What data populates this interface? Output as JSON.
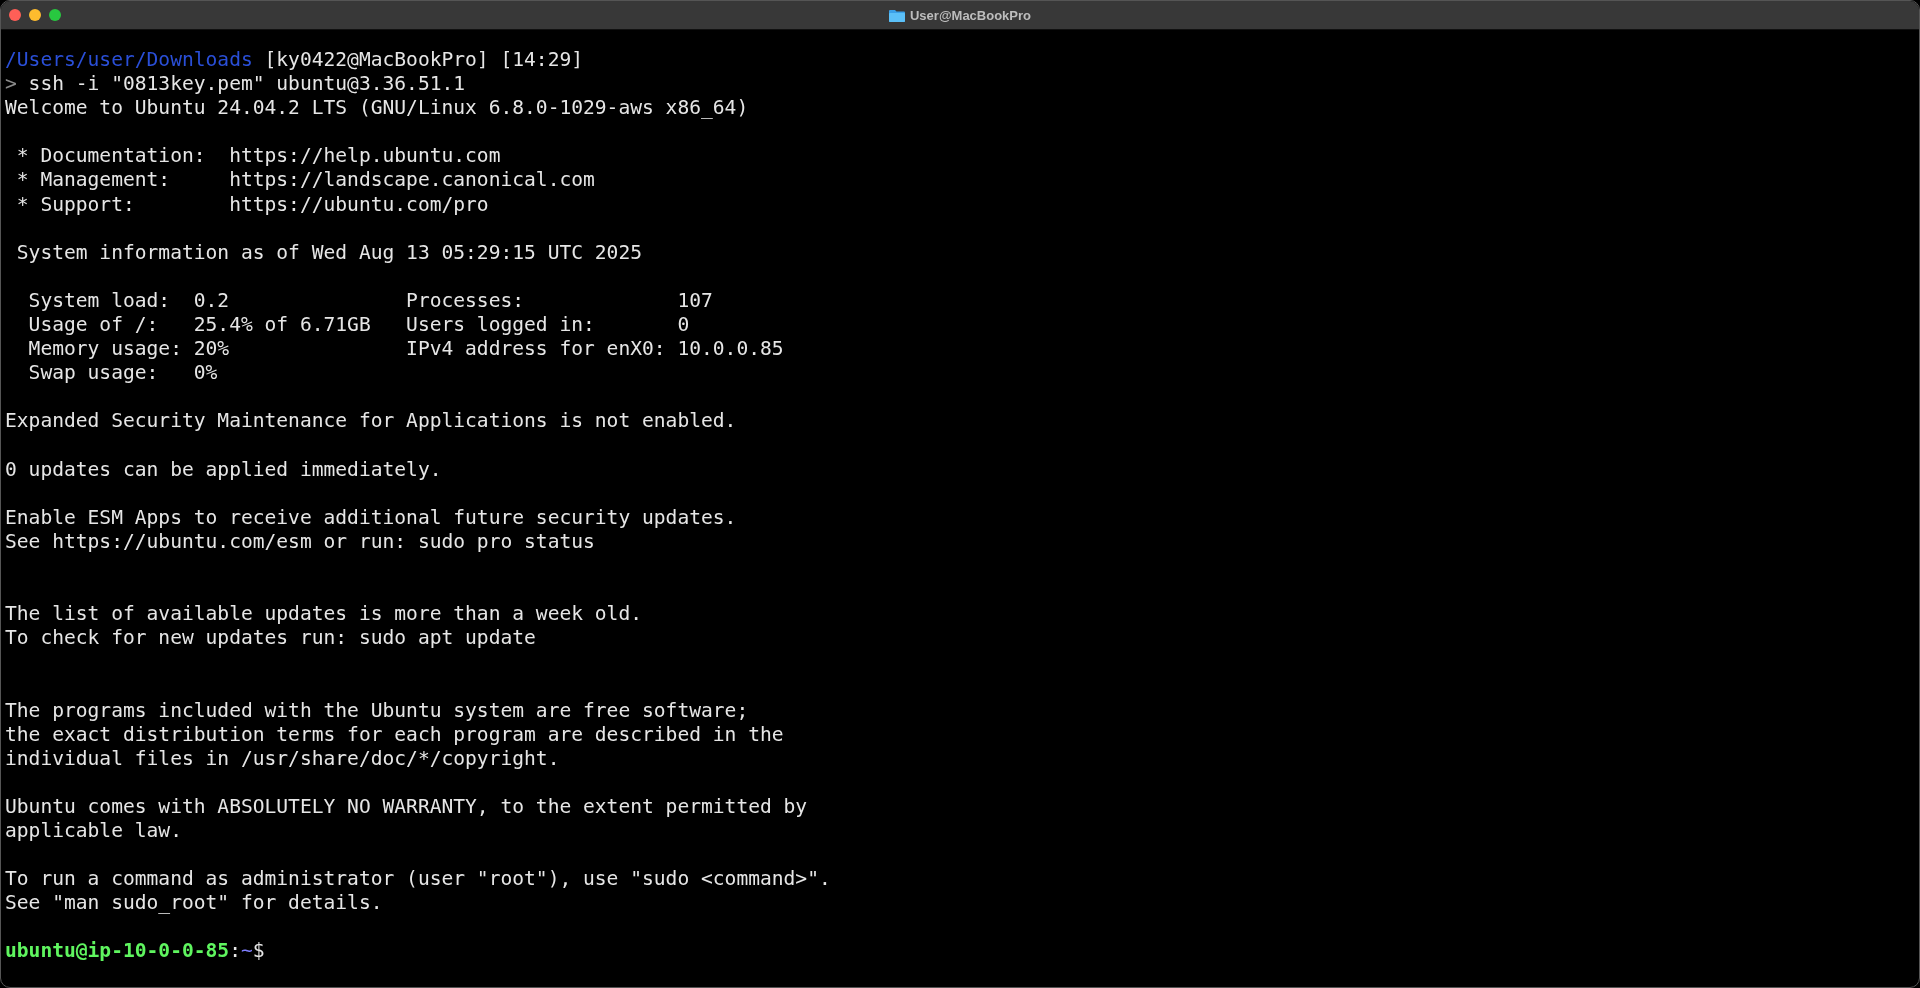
{
  "window": {
    "title": "User@MacBookPro"
  },
  "terminal": {
    "lines": [
      {
        "kind": "segments",
        "segments": [
          {
            "text": "/Users/user/Downloads",
            "kind": "path"
          },
          {
            "text": " [ky0422@MacBookPro] [14:29]",
            "kind": "plain"
          }
        ]
      },
      {
        "kind": "segments",
        "segments": [
          {
            "text": ">",
            "kind": "dim"
          },
          {
            "text": " ssh -i \"0813key.pem\" ubuntu@3.36.51.1",
            "kind": "plain"
          }
        ]
      },
      {
        "kind": "text",
        "text": "Welcome to Ubuntu 24.04.2 LTS (GNU/Linux 6.8.0-1029-aws x86_64)"
      },
      {
        "kind": "blank"
      },
      {
        "kind": "text",
        "text": " * Documentation:  https://help.ubuntu.com"
      },
      {
        "kind": "text",
        "text": " * Management:     https://landscape.canonical.com"
      },
      {
        "kind": "text",
        "text": " * Support:        https://ubuntu.com/pro"
      },
      {
        "kind": "blank"
      },
      {
        "kind": "text",
        "text": " System information as of Wed Aug 13 05:29:15 UTC 2025"
      },
      {
        "kind": "blank"
      },
      {
        "kind": "text",
        "text": "  System load:  0.2               Processes:             107"
      },
      {
        "kind": "text",
        "text": "  Usage of /:   25.4% of 6.71GB   Users logged in:       0"
      },
      {
        "kind": "text",
        "text": "  Memory usage: 20%               IPv4 address for enX0: 10.0.0.85"
      },
      {
        "kind": "text",
        "text": "  Swap usage:   0%"
      },
      {
        "kind": "blank"
      },
      {
        "kind": "text",
        "text": "Expanded Security Maintenance for Applications is not enabled."
      },
      {
        "kind": "blank"
      },
      {
        "kind": "text",
        "text": "0 updates can be applied immediately."
      },
      {
        "kind": "blank"
      },
      {
        "kind": "text",
        "text": "Enable ESM Apps to receive additional future security updates."
      },
      {
        "kind": "text",
        "text": "See https://ubuntu.com/esm or run: sudo pro status"
      },
      {
        "kind": "blank"
      },
      {
        "kind": "blank"
      },
      {
        "kind": "text",
        "text": "The list of available updates is more than a week old."
      },
      {
        "kind": "text",
        "text": "To check for new updates run: sudo apt update"
      },
      {
        "kind": "blank"
      },
      {
        "kind": "blank"
      },
      {
        "kind": "text",
        "text": "The programs included with the Ubuntu system are free software;"
      },
      {
        "kind": "text",
        "text": "the exact distribution terms for each program are described in the"
      },
      {
        "kind": "text",
        "text": "individual files in /usr/share/doc/*/copyright."
      },
      {
        "kind": "blank"
      },
      {
        "kind": "text",
        "text": "Ubuntu comes with ABSOLUTELY NO WARRANTY, to the extent permitted by"
      },
      {
        "kind": "text",
        "text": "applicable law."
      },
      {
        "kind": "blank"
      },
      {
        "kind": "text",
        "text": "To run a command as administrator (user \"root\"), use \"sudo <command>\"."
      },
      {
        "kind": "text",
        "text": "See \"man sudo_root\" for details."
      },
      {
        "kind": "blank"
      },
      {
        "kind": "segments",
        "segments": [
          {
            "text": "ubuntu@ip-10-0-0-85",
            "kind": "host"
          },
          {
            "text": ":",
            "kind": "plain"
          },
          {
            "text": "~",
            "kind": "dir"
          },
          {
            "text": "$",
            "kind": "plain"
          }
        ]
      }
    ]
  }
}
